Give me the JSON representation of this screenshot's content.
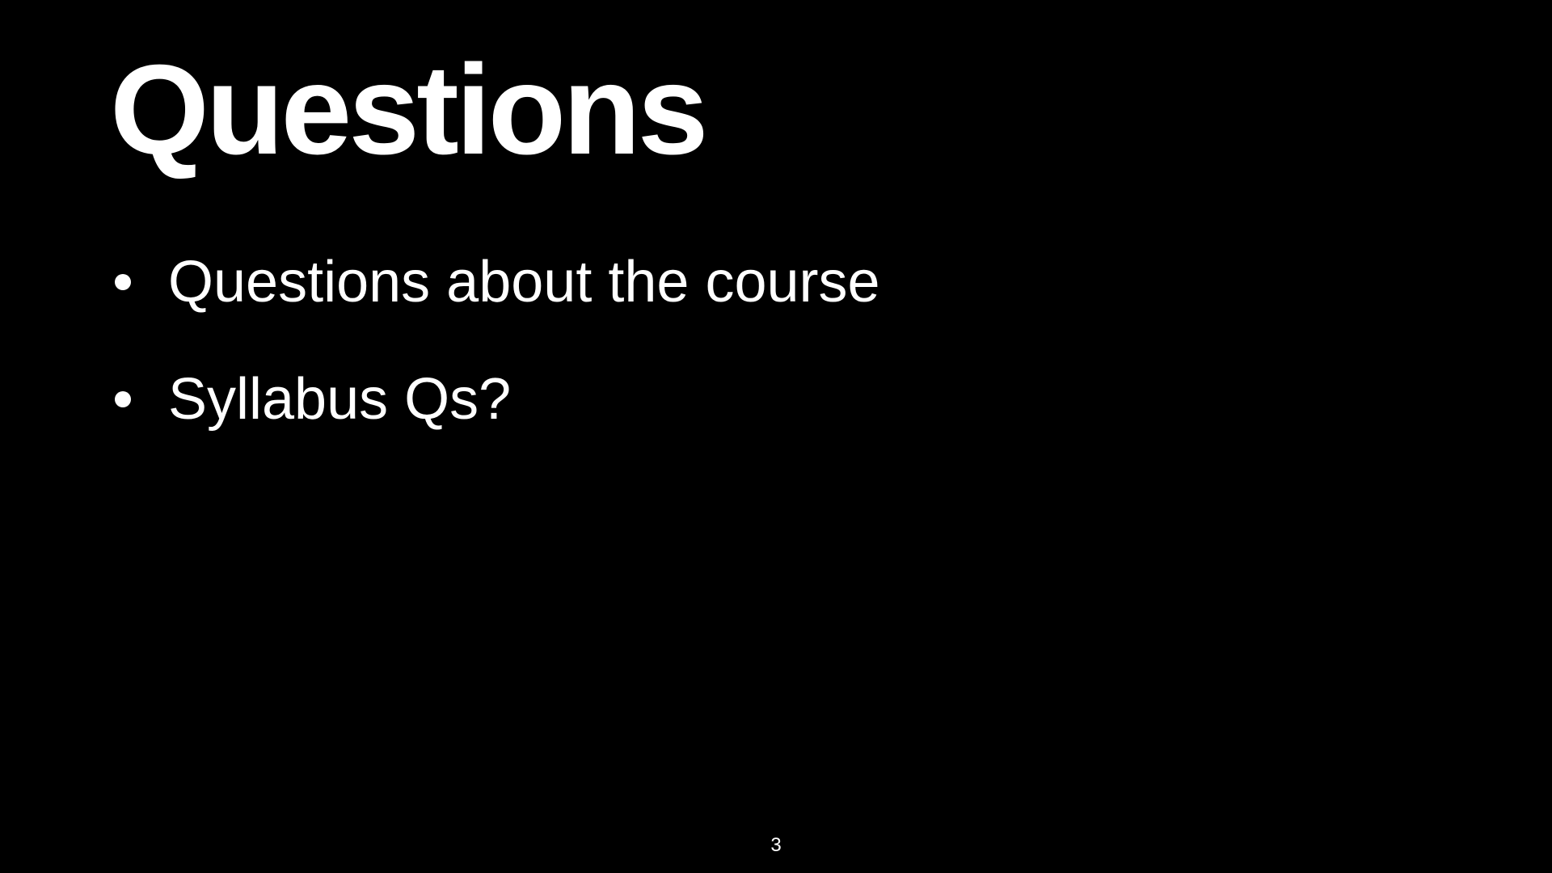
{
  "slide": {
    "title": "Questions",
    "bullets": [
      {
        "text": "Questions about the course"
      },
      {
        "text": "Syllabus Qs?"
      }
    ],
    "page_number": "3"
  },
  "colors": {
    "background": "#000000",
    "text": "#ffffff"
  }
}
